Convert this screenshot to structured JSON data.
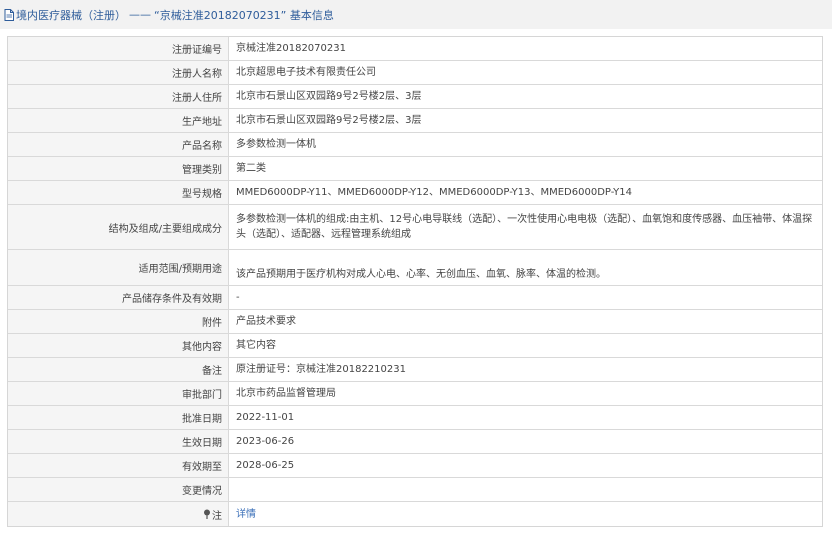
{
  "header": {
    "category": "境内医疗器械（注册）",
    "separator": "——",
    "record_title": "“京械注准20182070231” 基本信息"
  },
  "rows": [
    {
      "label": "注册证编号",
      "value": "京械注准20182070231"
    },
    {
      "label": "注册人名称",
      "value": "北京超思电子技术有限责任公司"
    },
    {
      "label": "注册人住所",
      "value": "北京市石景山区双园路9号2号楼2层、3层"
    },
    {
      "label": "生产地址",
      "value": "北京市石景山区双园路9号2号楼2层、3层"
    },
    {
      "label": "产品名称",
      "value": "多参数检测一体机"
    },
    {
      "label": "管理类别",
      "value": "第二类"
    },
    {
      "label": "型号规格",
      "value": "MMED6000DP-Y11、MMED6000DP-Y12、MMED6000DP-Y13、MMED6000DP-Y14"
    },
    {
      "label": "结构及组成/主要组成成分",
      "value": "多参数检测一体机的组成:由主机、12号心电导联线（选配）、一次性使用心电电极（选配）、血氧饱和度传感器、血压袖带、体温探头（选配）、适配器、远程管理系统组成"
    },
    {
      "label": "适用范围/预期用途",
      "value": "该产品预期用于医疗机构对成人心电、心率、无创血压、血氧、脉率、体温的检测。"
    },
    {
      "label": "产品储存条件及有效期",
      "value": "-"
    },
    {
      "label": "附件",
      "value": "产品技术要求"
    },
    {
      "label": "其他内容",
      "value": "其它内容"
    },
    {
      "label": "备注",
      "value": "原注册证号：京械注准20182210231"
    },
    {
      "label": "审批部门",
      "value": "北京市药品监督管理局"
    },
    {
      "label": "批准日期",
      "value": "2022-11-01"
    },
    {
      "label": "生效日期",
      "value": "2023-06-26"
    },
    {
      "label": "有效期至",
      "value": "2028-06-25"
    },
    {
      "label": "变更情况",
      "value": ""
    }
  ],
  "note_row": {
    "label": "注",
    "link_text": "详情"
  },
  "colors": {
    "header_bg": "#f2f2f2",
    "header_text": "#2f5d9b",
    "label_bg": "#f5f5f5",
    "border": "#d9d9d9",
    "link": "#3a6fb8"
  },
  "icons": {
    "header_icon": "document-icon",
    "note_icon": "pin-icon"
  }
}
